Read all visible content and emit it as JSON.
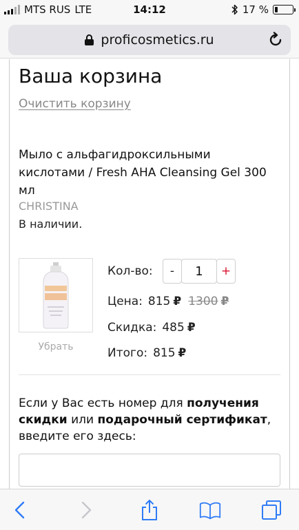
{
  "status_bar": {
    "carrier": "MTS RUS",
    "network": "LTE",
    "time": "14:12",
    "battery_percent": "17 %",
    "battery_level": 0.17,
    "icons": [
      "signal-icon",
      "bluetooth-icon",
      "battery-icon"
    ]
  },
  "browser": {
    "url": "proficosmetics.ru",
    "icons": [
      "lock-icon",
      "reload-icon"
    ]
  },
  "cart": {
    "title": "Ваша корзина",
    "clear_label": "Очистить корзину",
    "item": {
      "name": "Мыло с альфагидроксильными кислотами / Fresh AHA Cleansing Gel 300 мл",
      "brand": "CHRISTINA",
      "stock": "В наличии.",
      "remove_label": "Убрать",
      "qty_label": "Кол-во:",
      "qty_minus": "-",
      "qty_value": "1",
      "qty_plus": "+",
      "price_label": "Цена:",
      "price": "815",
      "old_price": "1300",
      "discount_label": "Скидка:",
      "discount": "485",
      "total_label": "Итого:",
      "total": "815",
      "currency": "₽"
    },
    "promo": {
      "text_1": "Если у Вас есть номер для ",
      "text_bold_1": "получения скидки",
      "text_2": " или ",
      "text_bold_2": "подарочный сертификат",
      "text_3": ", введите его здесь:",
      "input_value": ""
    }
  },
  "toolbar": {
    "icons": [
      "back-icon",
      "forward-icon",
      "share-icon",
      "bookmarks-icon",
      "tabs-icon"
    ]
  },
  "colors": {
    "accent_plus": "#d9102d",
    "ios_blue": "#2f7bf6",
    "muted_text": "#888888"
  }
}
